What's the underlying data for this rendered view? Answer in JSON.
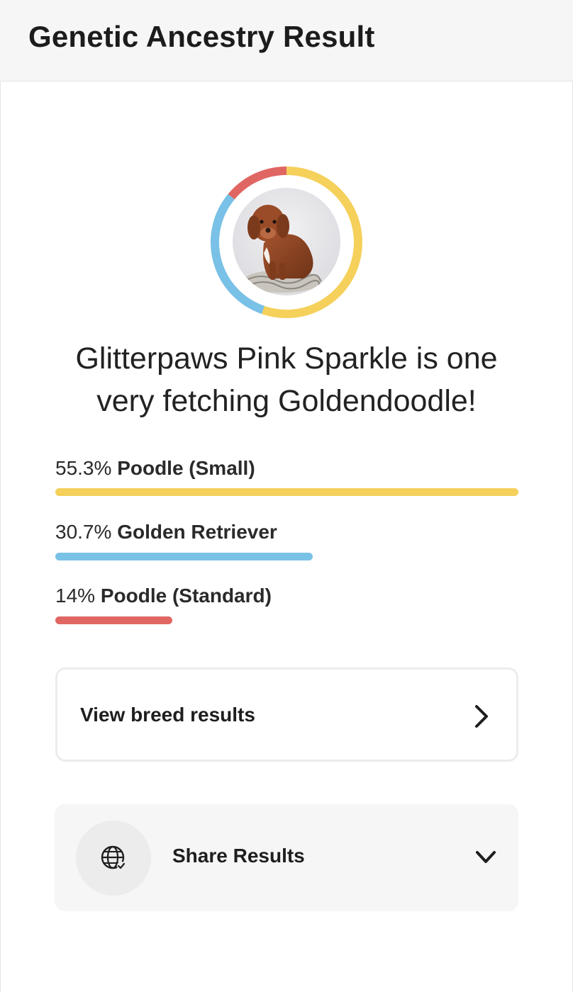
{
  "header": {
    "title": "Genetic Ancestry Result"
  },
  "pet": {
    "photo_icon": "dog-photo"
  },
  "headline": {
    "line1": "Glitterpaws Pink Sparkle is one",
    "line2": "very fetching Goldendoodle!"
  },
  "breeds": [
    {
      "percent_label": "55.3%",
      "name": "Poodle (Small)",
      "value": 55.3,
      "color": "#f5d05a"
    },
    {
      "percent_label": "30.7%",
      "name": "Golden Retriever",
      "value": 30.7,
      "color": "#79c1e6"
    },
    {
      "percent_label": "14%",
      "name": "Poodle (Standard)",
      "value": 14,
      "color": "#e06663"
    }
  ],
  "actions": {
    "view_breed_results": {
      "label": "View breed results",
      "icon": "chevron-right-icon"
    },
    "share_results": {
      "label": "Share Results",
      "icon": "globe-share-icon",
      "toggle_icon": "chevron-down-icon"
    }
  }
}
